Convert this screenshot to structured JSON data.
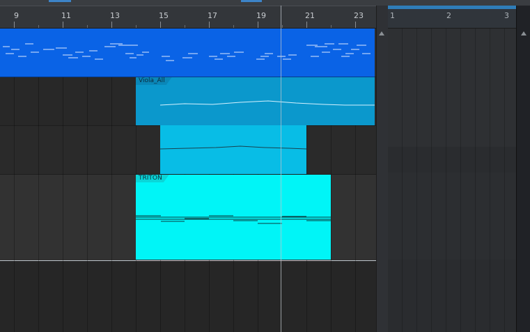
{
  "ruler": {
    "bars": [
      "9",
      "11",
      "13",
      "15",
      "17",
      "19",
      "21",
      "23"
    ]
  },
  "clips": {
    "viola": {
      "label": "Viola_All"
    },
    "triton": {
      "label": "TRITON"
    }
  },
  "right_ruler": {
    "bars": [
      "1",
      "2",
      "3"
    ]
  },
  "colors": {
    "midi_clip": "#0a63e6",
    "viola_clip": "#0b98cc",
    "viola_sub_clip": "#08bde6",
    "triton_clip": "#00f5f7",
    "accent": "#2f7db8"
  }
}
